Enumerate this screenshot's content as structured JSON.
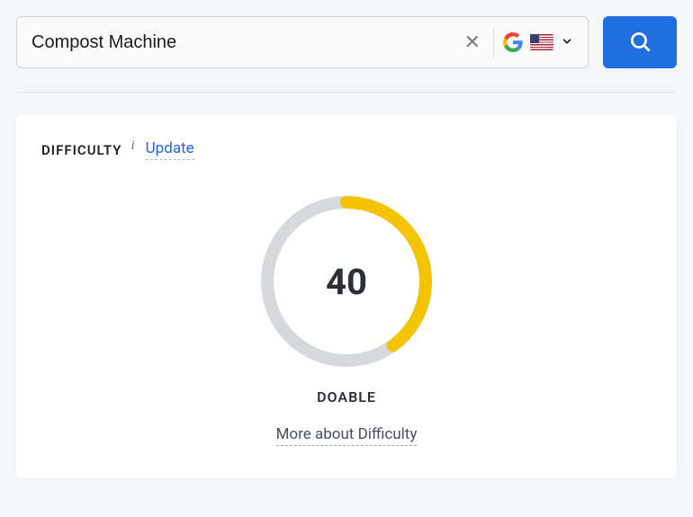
{
  "search": {
    "value": "Compost Machine"
  },
  "card": {
    "title": "DIFFICULTY",
    "update_label": "Update",
    "more_label": "More about Difficulty"
  },
  "chart_data": {
    "type": "pie",
    "value": 40,
    "max": 100,
    "label": "DOABLE",
    "colors": {
      "track": "#d6d8dc",
      "progress": "#f5c400"
    }
  }
}
